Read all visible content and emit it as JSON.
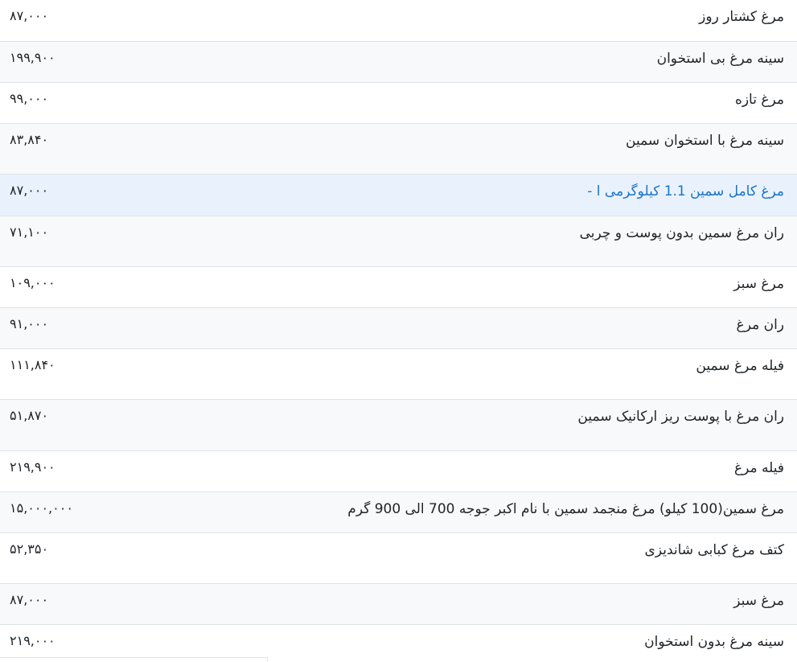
{
  "products": [
    {
      "name": "مرغ کشتار روز",
      "price": "۸۷,۰۰۰"
    },
    {
      "name": "سینه مرغ بی استخوان",
      "price": "۱۹۹,۹۰۰"
    },
    {
      "name": "مرغ تازه",
      "price": "۹۹,۰۰۰"
    },
    {
      "name": "سینه مرغ با استخوان سمین",
      "price": "۸۳,۸۴۰"
    },
    {
      "name": "مرغ کامل سمین 1.1 کیلوگرمی ا -",
      "price": "۸۷,۰۰۰"
    },
    {
      "name": "ران مرغ سمین بدون پوست و چربی",
      "price": "۷۱,۱۰۰"
    },
    {
      "name": "مرغ سبز",
      "price": "۱۰۹,۰۰۰"
    },
    {
      "name": "ران مرغ",
      "price": "۹۱,۰۰۰"
    },
    {
      "name": "فیله مرغ سمین",
      "price": "۱۱۱,۸۴۰"
    },
    {
      "name": "ران مرغ با پوست ریز ارکانیک سمین",
      "price": "۵۱,۸۷۰"
    },
    {
      "name": "فیله مرغ",
      "price": "۲۱۹,۹۰۰"
    },
    {
      "name": "مرغ سمین(100 کیلو) مرغ منجمد سمین با نام اکبر جوجه 700 الی 900 گرم",
      "price": "۱۵,۰۰۰,۰۰۰"
    },
    {
      "name": "کتف مرغ کبابی شاندیزی",
      "price": "۵۲,۳۵۰"
    },
    {
      "name": "مرغ سبز",
      "price": "۸۷,۰۰۰"
    },
    {
      "name": "سینه مرغ بدون استخوان",
      "price": "۲۱۹,۰۰۰"
    }
  ]
}
